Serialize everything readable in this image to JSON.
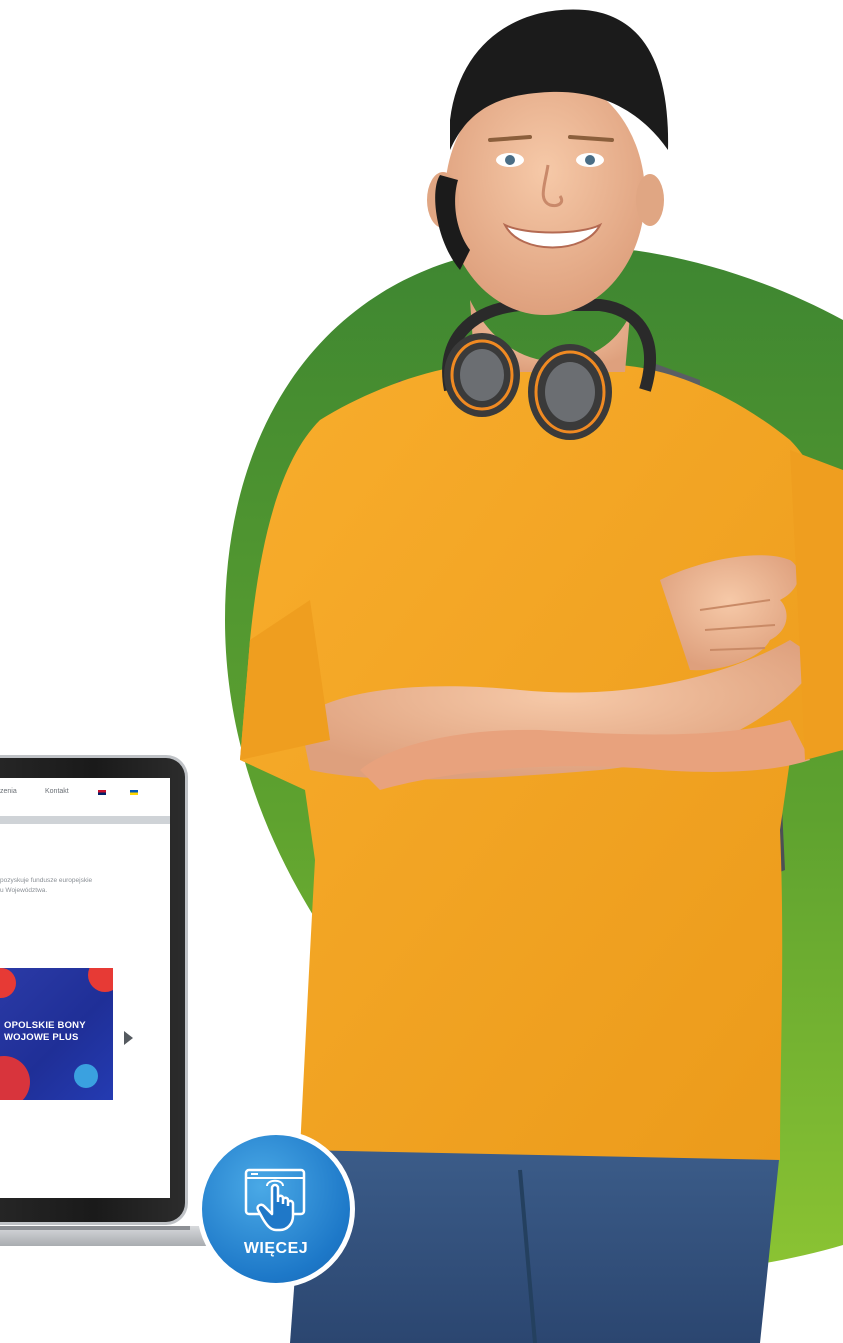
{
  "site": {
    "nav": [
      "zenia",
      "Kontakt"
    ],
    "text_lines": [
      "pozyskuje fundusze europejskie",
      "u Województwa."
    ],
    "banner": {
      "line1": "OPOLSKIE BONY",
      "line2": "WOJOWE PLUS"
    }
  },
  "cta": {
    "label": "WIĘCEJ"
  },
  "colors": {
    "green_top": "#3f8a31",
    "green_bottom": "#89c232",
    "shirt": "#f5a623",
    "button_blue": "#1f78c8"
  }
}
